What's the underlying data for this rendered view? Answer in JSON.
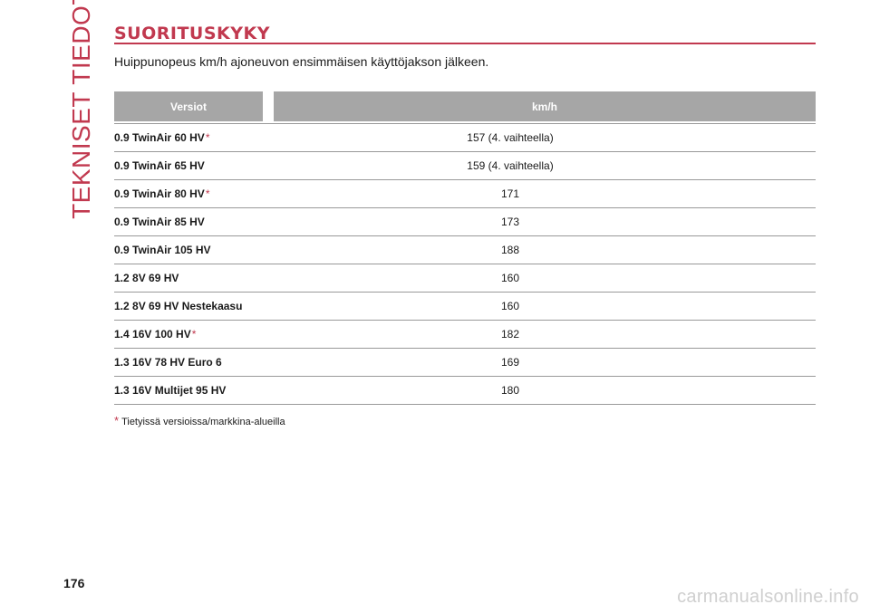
{
  "side_title": "TEKNISET TIEDOT",
  "title": "SUORITUSKYKY",
  "subtitle": "Huippunopeus km/h ajoneuvon ensimmäisen käyttöjakson jälkeen.",
  "table": {
    "headers": {
      "version": "Versiot",
      "speed": "km/h"
    },
    "rows": [
      {
        "version": "0.9 TwinAir 60 HV",
        "star": "*",
        "speed": "157 (4. vaihteella)"
      },
      {
        "version": "0.9 TwinAir 65 HV",
        "star": "",
        "speed": "159 (4. vaihteella)"
      },
      {
        "version": "0.9 TwinAir 80 HV",
        "star": "*",
        "speed": "171"
      },
      {
        "version": "0.9 TwinAir 85 HV",
        "star": "",
        "speed": "173"
      },
      {
        "version": "0.9 TwinAir 105 HV",
        "star": "",
        "speed": "188"
      },
      {
        "version": "1.2 8V 69 HV",
        "star": "",
        "speed": "160"
      },
      {
        "version": "1.2 8V 69 HV Nestekaasu",
        "star": "",
        "speed": "160"
      },
      {
        "version": "1.4 16V 100 HV",
        "star": "*",
        "speed": "182"
      },
      {
        "version": "1.3 16V 78 HV Euro 6",
        "star": "",
        "speed": "169"
      },
      {
        "version": "1.3 16V Multijet 95 HV",
        "star": "",
        "speed": "180"
      }
    ]
  },
  "footnote": {
    "star": "*",
    "text": "Tietyissä versioissa/markkina-alueilla"
  },
  "page_number": "176",
  "watermark": "carmanualsonline.info",
  "colors": {
    "accent": "#c1394f",
    "header_bg": "#a6a6a6",
    "rule": "#999999"
  }
}
